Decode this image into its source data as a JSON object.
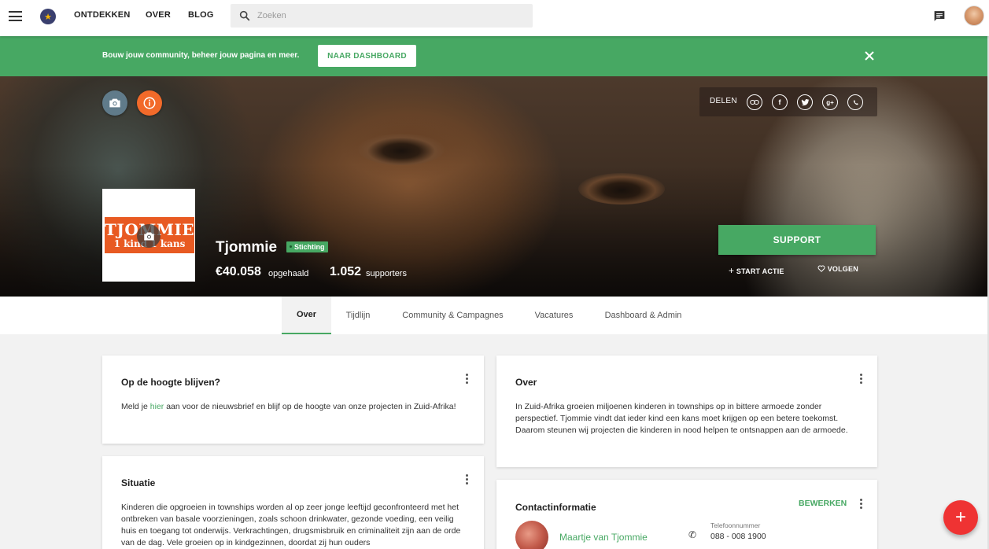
{
  "nav": {
    "links": [
      "ONTDEKKEN",
      "OVER",
      "BLOG"
    ],
    "search_placeholder": "Zoeken"
  },
  "banner": {
    "text": "Bouw jouw community, beheer jouw pagina en meer.",
    "button": "NAAR DASHBOARD"
  },
  "hero": {
    "share_label": "DELEN",
    "share_icons": [
      "link-icon",
      "facebook-icon",
      "twitter-icon",
      "google-plus-icon",
      "whatsapp-icon"
    ],
    "org_logo": {
      "line1": "TJOMMIE",
      "line2": "1 kind 1 kans"
    },
    "org_name": "Tjommie",
    "badge": "Stichting",
    "raised_value": "€40.058",
    "raised_label": "opgehaald",
    "supporters_value": "1.052",
    "supporters_label": "supporters",
    "support_button": "SUPPORT",
    "start_action": "START ACTIE",
    "follow": "VOLGEN"
  },
  "tabs": [
    "Over",
    "Tijdlijn",
    "Community & Campagnes",
    "Vacatures",
    "Dashboard & Admin"
  ],
  "active_tab": "Over",
  "cards": {
    "stay_updated": {
      "title": "Op de hoogte blijven?",
      "body_pre": "Meld je ",
      "body_link": "hier",
      "body_post": " aan voor de nieuwsbrief en blijf op de hoogte van onze projecten in Zuid-Afrika!"
    },
    "situation": {
      "title": "Situatie",
      "body": "Kinderen die opgroeien in townships worden al op zeer jonge leeftijd geconfronteerd met het ontbreken van basale voorzieningen, zoals schoon drinkwater, gezonde voeding, een veilig huis en toegang tot onderwijs. Verkrachtingen, drugsmisbruik en criminaliteit zijn aan de orde van de dag. Vele groeien op in kindgezinnen, doordat zij hun ouders"
    },
    "about": {
      "title": "Over",
      "body": "In Zuid-Afrika groeien miljoenen kinderen in townships op in bittere armoede zonder perspectief. Tjommie vindt dat ieder kind een kans moet krijgen op een betere toekomst. Daarom steunen wij projecten die kinderen in nood helpen te ontsnappen aan de armoede."
    },
    "contact": {
      "title": "Contactinformatie",
      "edit": "BEWERKEN",
      "name": "Maartje van Tjommie",
      "phone_label": "Telefoonnummer",
      "phone_value": "088 - 008 1900"
    }
  },
  "colors": {
    "brand_green": "#47a863",
    "fab_red": "#ef3333",
    "info_orange": "#f26a2a"
  }
}
